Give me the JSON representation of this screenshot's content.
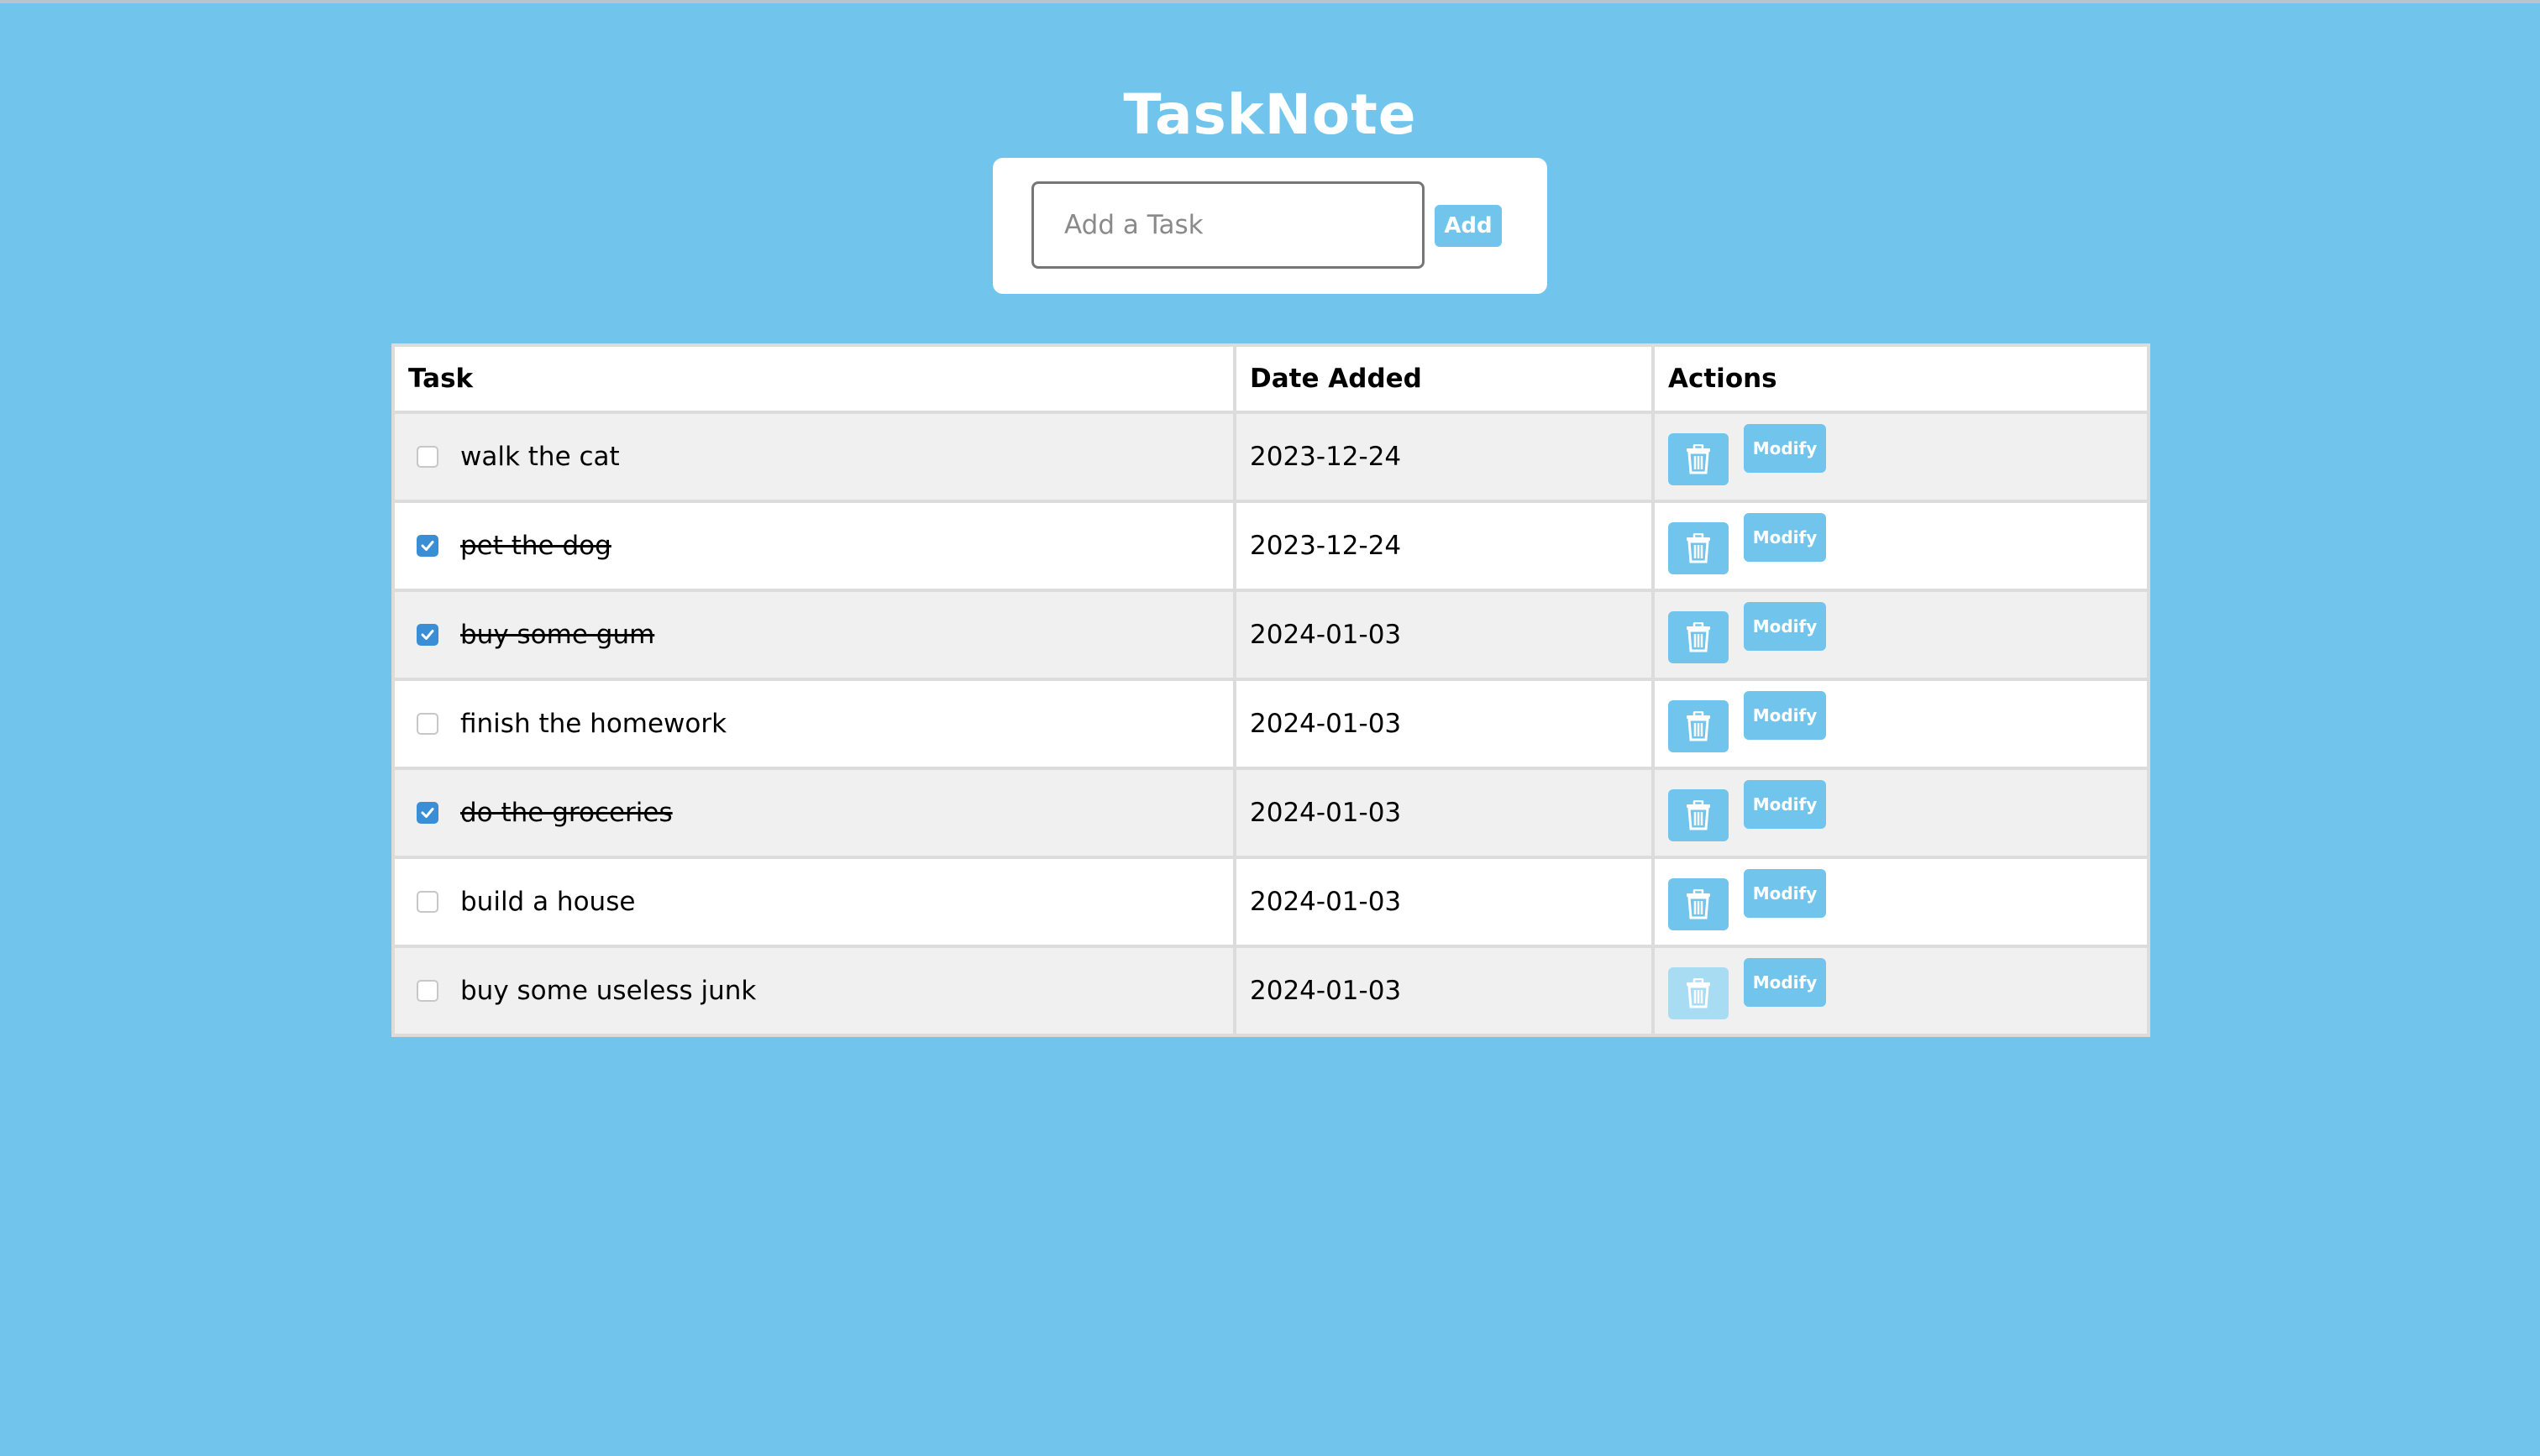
{
  "app": {
    "title": "TaskNote"
  },
  "add_form": {
    "placeholder": "Add a Task",
    "add_label": "Add"
  },
  "table": {
    "headers": {
      "task": "Task",
      "date": "Date Added",
      "actions": "Actions"
    },
    "rows": [
      {
        "task": "walk the cat",
        "date": "2023-12-24",
        "done": false,
        "modify_label": "Modify"
      },
      {
        "task": "pet the dog",
        "date": "2023-12-24",
        "done": true,
        "modify_label": "Modify"
      },
      {
        "task": "buy some gum",
        "date": "2024-01-03",
        "done": true,
        "modify_label": "Modify"
      },
      {
        "task": "finish the homework",
        "date": "2024-01-03",
        "done": false,
        "modify_label": "Modify"
      },
      {
        "task": "do the groceries",
        "date": "2024-01-03",
        "done": true,
        "modify_label": "Modify"
      },
      {
        "task": "build a house",
        "date": "2024-01-03",
        "done": false,
        "modify_label": "Modify"
      },
      {
        "task": "buy some useless junk",
        "date": "2024-01-03",
        "done": false,
        "modify_label": "Modify"
      }
    ]
  },
  "icons": {
    "delete": "trash-icon",
    "checkbox": "checkbox"
  },
  "colors": {
    "background": "#71c5ec",
    "accent": "#71c5ec",
    "checkbox_checked": "#3a8ed6"
  }
}
